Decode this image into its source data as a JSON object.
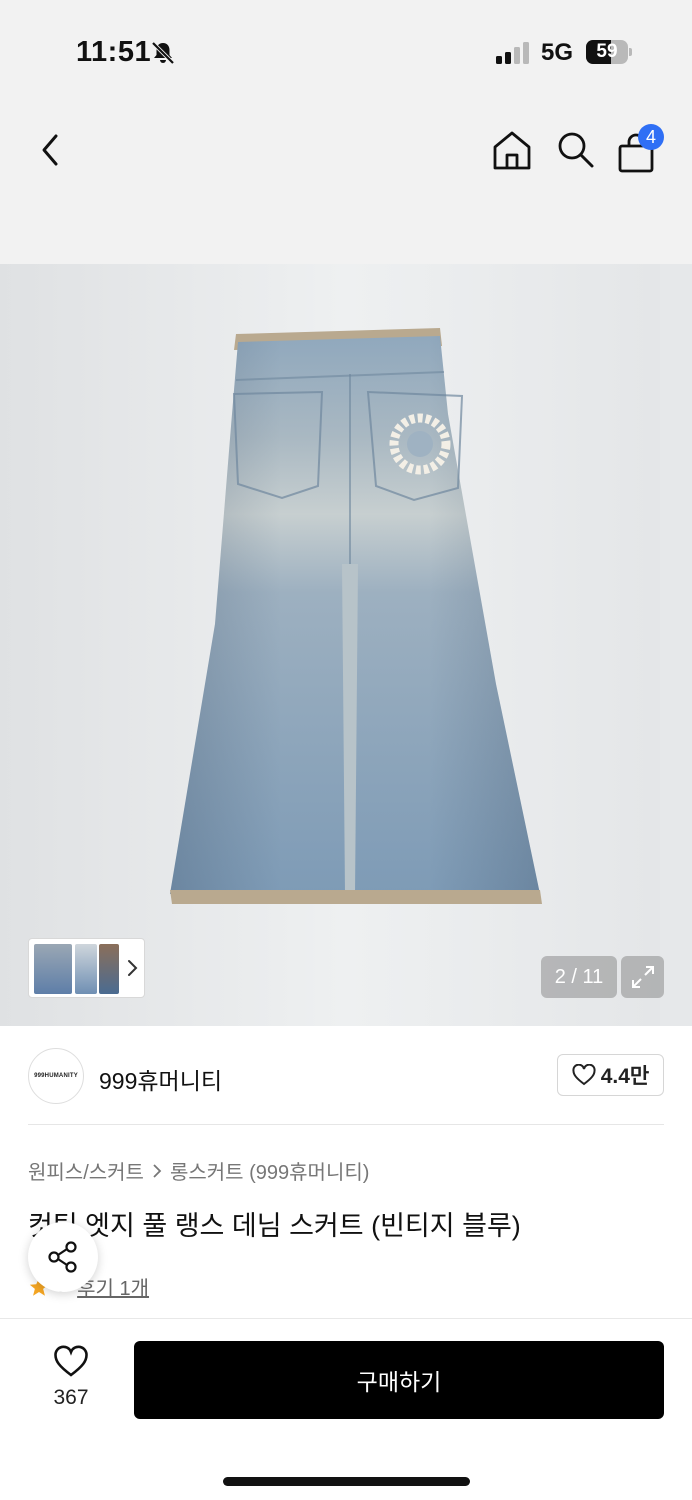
{
  "status_bar": {
    "time": "11:51",
    "network": "5G",
    "battery": "59",
    "battery_level": 0.59
  },
  "nav": {
    "cart_count": "4"
  },
  "gallery": {
    "counter": "2 / 11"
  },
  "brand": {
    "logo_text": "999HUMANITY",
    "name": "999휴머니티",
    "likes": "4.4만"
  },
  "product": {
    "breadcrumb": [
      "원피스/스커트",
      "롱스커트 (999휴머니티)"
    ],
    "title": "컷팅 엣지 풀 랭스 데님 스커트 (빈티지 블루)",
    "rating": "5",
    "reviews": "후기 1개"
  },
  "bottom_bar": {
    "like_count": "367",
    "buy_label": "구매하기"
  },
  "colors": {
    "accent": "#2f6ff5",
    "buy_button": "#000000",
    "star": "#f5a623"
  }
}
